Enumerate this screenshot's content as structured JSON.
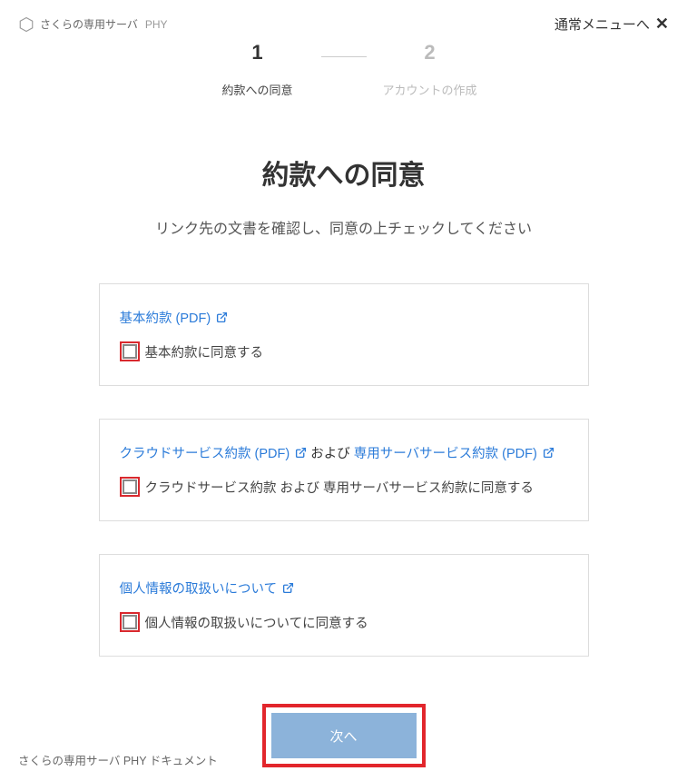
{
  "header": {
    "brand": "さくらの専用サーバ",
    "sub_brand": "PHY",
    "normal_menu": "通常メニューへ"
  },
  "stepper": {
    "step1": {
      "number": "1",
      "label": "約款への同意"
    },
    "step2": {
      "number": "2",
      "label": "アカウントの作成"
    }
  },
  "main": {
    "title": "約款への同意",
    "subtitle": "リンク先の文書を確認し、同意の上チェックしてください"
  },
  "cards": [
    {
      "links": [
        {
          "text": "基本約款 (PDF)"
        }
      ],
      "joiner": "",
      "check_label": "基本約款に同意する"
    },
    {
      "links": [
        {
          "text": "クラウドサービス約款 (PDF)"
        },
        {
          "text": "専用サーバサービス約款 (PDF)"
        }
      ],
      "joiner": " および ",
      "check_label": "クラウドサービス約款 および 専用サーバサービス約款に同意する"
    },
    {
      "links": [
        {
          "text": "個人情報の取扱いについて"
        }
      ],
      "joiner": "",
      "check_label": "個人情報の取扱いについてに同意する"
    }
  ],
  "buttons": {
    "next": "次へ"
  },
  "footer": {
    "doc_link": "さくらの専用サーバ PHY ドキュメント"
  }
}
